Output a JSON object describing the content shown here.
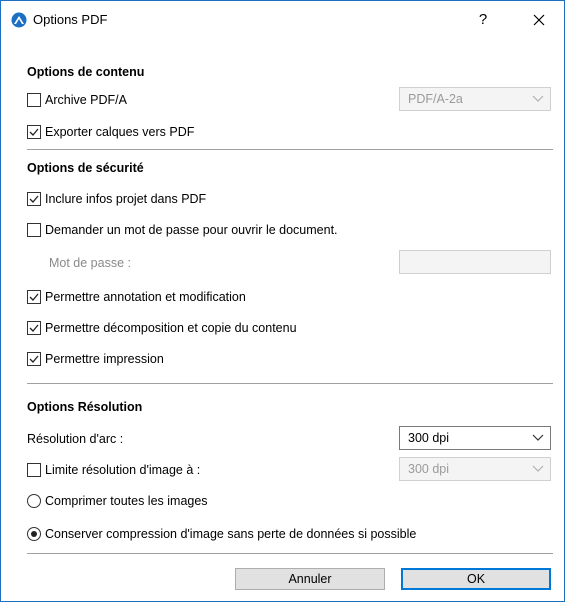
{
  "window": {
    "title": "Options PDF",
    "help_label": "?",
    "accent_color": "#1c6fc2"
  },
  "content_options": {
    "header": "Options de contenu",
    "archive_pdfa": {
      "label": "Archive PDF/A",
      "checked": false
    },
    "pdfa_select": {
      "value": "PDF/A-2a",
      "enabled": false
    },
    "export_layers": {
      "label": "Exporter calques vers PDF",
      "checked": true
    }
  },
  "security_options": {
    "header": "Options de sécurité",
    "include_project_info": {
      "label": "Inclure infos projet dans PDF",
      "checked": true
    },
    "require_password": {
      "label": "Demander un mot de passe pour ouvrir le document.",
      "checked": false
    },
    "password_label": "Mot de passe :",
    "password_value": "",
    "allow_annotation": {
      "label": "Permettre annotation et modification",
      "checked": true
    },
    "allow_copy": {
      "label": "Permettre décomposition et copie du contenu",
      "checked": true
    },
    "allow_print": {
      "label": "Permettre impression",
      "checked": true
    }
  },
  "resolution_options": {
    "header": "Options Résolution",
    "arc_resolution_label": "Résolution d'arc :",
    "arc_resolution_value": "300 dpi",
    "limit_image_resolution": {
      "label": "Limite résolution d'image à :",
      "checked": false
    },
    "image_resolution_value": "300 dpi",
    "compress_all": {
      "label": "Comprimer toutes les images",
      "selected": false
    },
    "keep_compression": {
      "label": "Conserver compression d'image sans perte de données si possible",
      "selected": true
    }
  },
  "buttons": {
    "cancel": "Annuler",
    "ok": "OK"
  }
}
